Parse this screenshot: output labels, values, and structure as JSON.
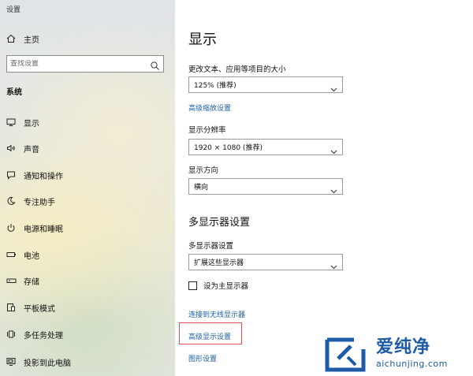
{
  "window": {
    "title": "设置"
  },
  "sidebar": {
    "home_label": "主页",
    "search_placeholder": "查找设置",
    "group_header": "系统",
    "items": [
      {
        "label": "显示",
        "icon": "monitor-icon"
      },
      {
        "label": "声音",
        "icon": "speaker-icon"
      },
      {
        "label": "通知和操作",
        "icon": "notification-icon"
      },
      {
        "label": "专注助手",
        "icon": "moon-icon"
      },
      {
        "label": "电源和睡眠",
        "icon": "power-icon"
      },
      {
        "label": "电池",
        "icon": "battery-icon"
      },
      {
        "label": "存储",
        "icon": "storage-icon"
      },
      {
        "label": "平板模式",
        "icon": "tablet-mode-icon"
      },
      {
        "label": "多任务处理",
        "icon": "multitasking-icon"
      },
      {
        "label": "投影到此电脑",
        "icon": "projecting-icon"
      }
    ]
  },
  "main": {
    "title": "显示",
    "scale_label": "更改文本、应用等项目的大小",
    "scale_value": "125% (推荐)",
    "advanced_scaling_link": "高级缩放设置",
    "resolution_label": "显示分辨率",
    "resolution_value": "1920 × 1080 (推荐)",
    "orientation_label": "显示方向",
    "orientation_value": "横向",
    "multi_display_heading": "多显示器设置",
    "multi_display_label": "多显示器设置",
    "multi_display_value": "扩展这些显示器",
    "main_display_checkbox_label": "设为主显示器",
    "main_display_checked": false,
    "wireless_display_link": "连接到无线显示器",
    "advanced_display_link": "高级显示设置",
    "graphics_link": "图形设置"
  },
  "colors": {
    "link": "#1b5fa3",
    "highlight_border": "#e15252",
    "watermark": "#1d5aa8"
  },
  "watermark": {
    "brand": "爱纯净",
    "url": "aichunjing.com"
  }
}
